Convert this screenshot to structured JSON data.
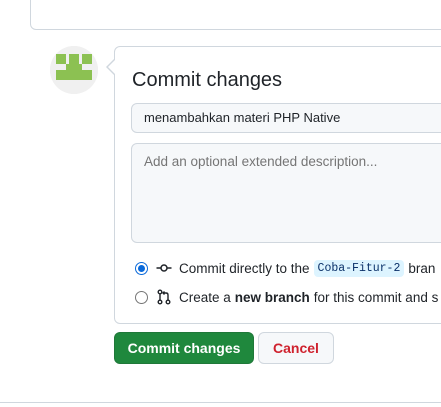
{
  "commit_form": {
    "title": "Commit changes",
    "summary_value": "menambahkan materi PHP Native",
    "description_placeholder": "Add an optional extended description...",
    "options": {
      "direct_prefix": "Commit directly to the",
      "branch_name": "Coba-Fitur-2",
      "direct_suffix": "bran",
      "new_branch_prefix": "Create a",
      "new_branch_bold": "new branch",
      "new_branch_suffix": "for this commit and s"
    },
    "selected_option": "direct",
    "commit_button_label": "Commit changes",
    "cancel_button_label": "Cancel"
  },
  "avatar": {
    "color": "#8cc152",
    "background": "#f0f0f0"
  },
  "icons": {
    "commit": "git-commit-icon",
    "new_branch": "git-pull-request-icon"
  },
  "colors": {
    "primary_button": "#1f883d",
    "cancel_text": "#cf222e",
    "radio_checked": "#0969da",
    "branch_badge_bg": "#ddf4ff"
  }
}
